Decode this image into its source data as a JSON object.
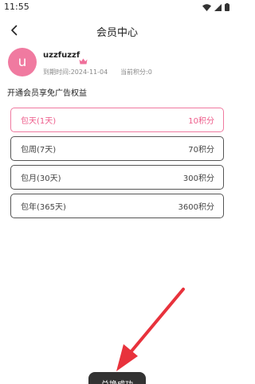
{
  "status_bar": {
    "time": "11:55",
    "icons": [
      "wifi-icon",
      "signal-icon",
      "battery-icon"
    ]
  },
  "header": {
    "title": "会员中心",
    "back_icon": "chevron-left-icon"
  },
  "profile": {
    "avatar_letter": "u",
    "avatar_color": "#f07aa0",
    "username": "uzzfuzzf",
    "crown_icon": "crown-icon",
    "expire_text": "到期时间:2024-11-04",
    "points_text": "当前积分:0"
  },
  "section": {
    "title": "开通会员享免广告权益"
  },
  "plans": [
    {
      "name": "包天(1天)",
      "price": "10积分",
      "selected": true
    },
    {
      "name": "包周(7天)",
      "price": "70积分",
      "selected": false
    },
    {
      "name": "包月(30天)",
      "price": "300积分",
      "selected": false
    },
    {
      "name": "包年(365天)",
      "price": "3600积分",
      "selected": false
    }
  ],
  "toast": {
    "text": "兑换成功"
  },
  "colors": {
    "accent": "#ee5b8a",
    "arrow": "#e8323c",
    "toast_bg": "#333333"
  }
}
